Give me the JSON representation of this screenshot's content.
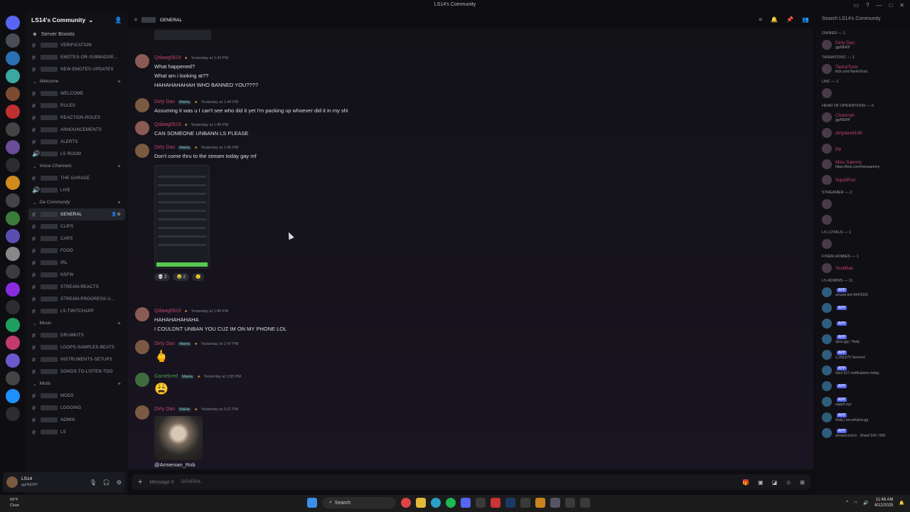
{
  "window": {
    "title": "LS14's Community"
  },
  "server": {
    "name": "LS14's Community",
    "boosts_label": "Server Boosts"
  },
  "channels": {
    "items": [
      {
        "type": "channel",
        "label": "Verification"
      },
      {
        "type": "channel",
        "label": "EMOTES-OR-SUBBADGE..."
      },
      {
        "type": "channel",
        "label": "NEW-EMOTES-UPDATES"
      },
      {
        "type": "category",
        "label": "Welcome"
      },
      {
        "type": "channel",
        "label": "WELCOME"
      },
      {
        "type": "channel",
        "label": "RULES"
      },
      {
        "type": "channel",
        "label": "REACTION-ROLES"
      },
      {
        "type": "channel",
        "label": "ANNOUNCEMENTS"
      },
      {
        "type": "channel",
        "label": "ALERTS"
      },
      {
        "type": "voice",
        "label": "LS ROOM"
      },
      {
        "type": "category",
        "label": "Voice Channels"
      },
      {
        "type": "channel",
        "label": "THE GARAGE"
      },
      {
        "type": "voice",
        "label": "LIVE"
      },
      {
        "type": "category",
        "label": "Da Community"
      },
      {
        "type": "active",
        "label": "GENERAL"
      },
      {
        "type": "channel",
        "label": "CLIPS"
      },
      {
        "type": "channel",
        "label": "CARS"
      },
      {
        "type": "channel",
        "label": "FOOD"
      },
      {
        "type": "channel",
        "label": "IRL"
      },
      {
        "type": "channel",
        "label": "NSFW"
      },
      {
        "type": "channel",
        "label": "STREAM-REACTS"
      },
      {
        "type": "channel",
        "label": "STREAM-PROGRESS-U..."
      },
      {
        "type": "channel",
        "label": "LS-TWITCHAPP"
      },
      {
        "type": "category",
        "label": "Music"
      },
      {
        "type": "channel",
        "label": "DRUMKITS"
      },
      {
        "type": "channel",
        "label": "LOOPS-SAMPLES-BEATS"
      },
      {
        "type": "channel",
        "label": "INSTRUMENTS-SETUPS"
      },
      {
        "type": "channel",
        "label": "SONGS-TO-LISTEN-TOO"
      },
      {
        "type": "category",
        "label": "Mods"
      },
      {
        "type": "channel",
        "label": "MODS"
      },
      {
        "type": "channel",
        "label": "LOGGING"
      },
      {
        "type": "channel",
        "label": "ADMIN"
      },
      {
        "type": "channel",
        "label": "ls"
      }
    ]
  },
  "user_panel": {
    "name": "LS14",
    "status": "gg/NERP"
  },
  "header": {
    "channel": "GENERAL",
    "search_placeholder": "Search LS14's Community"
  },
  "messages": [
    {
      "author": "Qdawg0619",
      "color": "red",
      "time": "Yesterday at 1:42 PM",
      "lines": [
        "What happened?",
        "What am i looking at??",
        "HAHAHAHAHAH WHO BANNED YOU????"
      ]
    },
    {
      "author": "Dirty Dan",
      "tag": "MaHa",
      "color": "red",
      "time": "Yesterday at 1:44 PM",
      "lines": [
        "Assuming it was u I can't see who did it yet I'm packing up whoever did it in my shi"
      ]
    },
    {
      "author": "Qdawg0619",
      "color": "red",
      "time": "Yesterday at 1:45 PM",
      "lines": [
        "CAN SOMEONE UNBANN LS PLEASE"
      ]
    },
    {
      "author": "Dirty Dan",
      "tag": "MaHa",
      "color": "red",
      "time": "Yesterday at 1:45 PM",
      "lines": [
        "Don't come thru to the stream today gay mf"
      ],
      "reactions": [
        "💀 2",
        "😂 2",
        "🙂"
      ]
    },
    {
      "author": "Qdawg0619",
      "color": "red",
      "time": "Yesterday at 1:45 PM",
      "lines": [
        "HAHAHAHAHAHA",
        "I COULDNT UNBAN YOU CUZ IM ON MY PHONE LOL"
      ]
    },
    {
      "author": "Dirty Dan",
      "tag": "MaHa",
      "color": "red",
      "time": "Yesterday at 1:47 PM",
      "emoji": "🖕"
    },
    {
      "author": "Gamebred",
      "tag": "MaHa",
      "color": "green",
      "time": "Yesterday at 1:55 PM",
      "emoji": "😩"
    },
    {
      "author": "Dirty Dan",
      "tag": "MaHa",
      "color": "red",
      "time": "Yesterday at 3:21 PM",
      "mention": "@Armenian_Rob"
    }
  ],
  "input": {
    "placeholder": "Message #",
    "channel": "GENERAL"
  },
  "members": {
    "groups": [
      {
        "header": "OWNER — 1",
        "members": [
          {
            "name": "Dirty Dan",
            "sub": "gg/NERP",
            "color": "#c2426a"
          }
        ]
      },
      {
        "header": "TashaToxic — 1",
        "members": [
          {
            "name": "TashaToxic",
            "sub": "kick.com/TashaToxic",
            "color": "#c2426a"
          }
        ]
      },
      {
        "header": "UNC — 1",
        "members": [
          {
            "name": "",
            "sub": "",
            "color": "#6a5acd"
          }
        ]
      },
      {
        "header": "HEAD OF OPERATIONS — 5",
        "members": [
          {
            "name": "Chamrah",
            "sub": "gg/NERP",
            "color": "#c2426a"
          },
          {
            "name": "dirtydan4198",
            "sub": "",
            "color": "#c2426a"
          },
          {
            "name": "jay",
            "sub": "",
            "color": "#c2426a"
          },
          {
            "name": "Miss Sammy",
            "sub": "https://kick.com/misssammy",
            "color": "#c2426a"
          },
          {
            "name": "SquidRon",
            "sub": "",
            "color": "#c2426a"
          }
        ]
      },
      {
        "header": "Streamer — 2",
        "members": [
          {
            "name": "",
            "sub": "",
            "color": "#c2426a"
          },
          {
            "name": "",
            "sub": "",
            "color": "#c2426a"
          }
        ]
      },
      {
        "header": "LS Loyals — 1",
        "members": [
          {
            "name": "",
            "sub": "",
            "color": "#6a5acd"
          }
        ]
      },
      {
        "header": "FIVEM HOMIES — 1",
        "members": [
          {
            "name": "YoullBan",
            "sub": "",
            "color": "#c2426a"
          }
        ]
      },
      {
        "header": "LS ADMINS — 11",
        "members": [
          {
            "name": "",
            "sub": "arcane.bot 644/1536",
            "color": "#7289da"
          },
          {
            "name": "",
            "sub": "",
            "color": "#7289da"
          },
          {
            "name": "",
            "sub": "",
            "color": "#7289da"
          },
          {
            "name": "",
            "sub": "dyno.gg | ?help",
            "color": "#7289da"
          },
          {
            "name": "",
            "sub": "1,258,675 Servers!",
            "color": "#7289da"
          },
          {
            "name": "",
            "sub": "Sent 917 notifications today.",
            "color": "#7289da"
          },
          {
            "name": "",
            "sub": "",
            "color": "#7289da"
          },
          {
            "name": "",
            "sub": "sapph.xyz",
            "color": "#7289da"
          },
          {
            "name": "",
            "sub": "/help | securitybot.gg",
            "color": "#7289da"
          },
          {
            "name": "",
            "sub": "streamcord.io · Shard 543 / 800",
            "color": "#7289da"
          }
        ]
      }
    ],
    "app_badge": "APP"
  },
  "taskbar": {
    "weather_temp": "69°F",
    "weather_desc": "Clear",
    "search_label": "Search",
    "time": "11:48 AM",
    "date": "4/12/2025"
  },
  "colors": {
    "accent": "#5865f2",
    "name_red": "#c2426a",
    "name_green": "#4b9d4b",
    "bg": "#0e0e12"
  }
}
